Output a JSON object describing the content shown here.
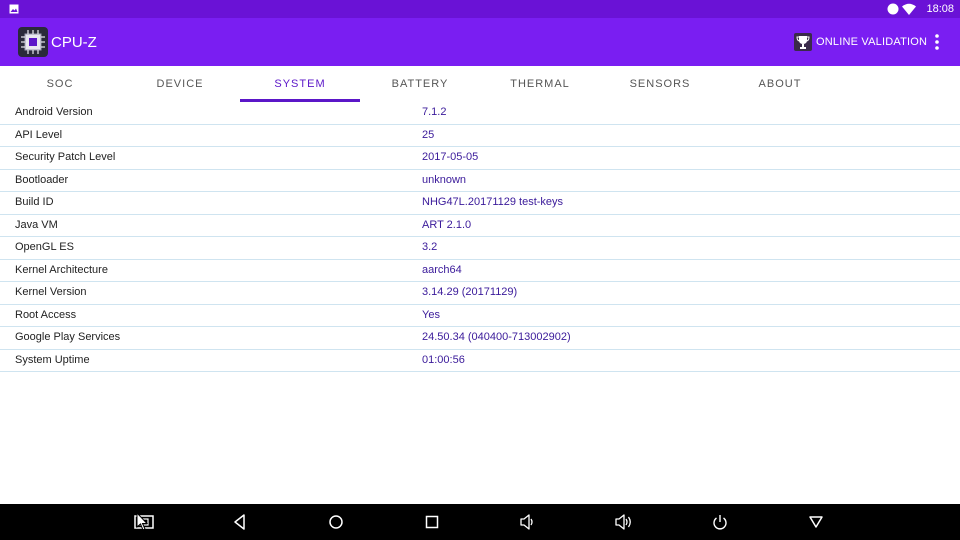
{
  "status_bar": {
    "time": "18:08"
  },
  "app_bar": {
    "title": "CPU-Z",
    "validation_label": "ONLINE VALIDATION",
    "accent_color": "#7a1ef2"
  },
  "tabs": [
    {
      "label": "SOC",
      "active": false
    },
    {
      "label": "DEVICE",
      "active": false
    },
    {
      "label": "SYSTEM",
      "active": true
    },
    {
      "label": "BATTERY",
      "active": false
    },
    {
      "label": "THERMAL",
      "active": false
    },
    {
      "label": "SENSORS",
      "active": false
    },
    {
      "label": "ABOUT",
      "active": false
    }
  ],
  "system_rows": [
    {
      "key": "Android Version",
      "value": "7.1.2"
    },
    {
      "key": "API Level",
      "value": "25"
    },
    {
      "key": "Security Patch Level",
      "value": "2017-05-05"
    },
    {
      "key": "Bootloader",
      "value": "unknown"
    },
    {
      "key": "Build ID",
      "value": "NHG47L.20171129 test-keys"
    },
    {
      "key": "Java VM",
      "value": "ART 2.1.0"
    },
    {
      "key": "OpenGL ES",
      "value": "3.2"
    },
    {
      "key": "Kernel Architecture",
      "value": "aarch64"
    },
    {
      "key": "Kernel Version",
      "value": "3.14.29 (20171129)"
    },
    {
      "key": "Root Access",
      "value": "Yes"
    },
    {
      "key": "Google Play Services",
      "value": "24.50.34 (040400-713002902)"
    },
    {
      "key": "System Uptime",
      "value": "01:00:56"
    }
  ],
  "nav_bar": {
    "icons": [
      "screenshot-icon",
      "back-icon",
      "home-icon",
      "recents-icon",
      "volume-down-icon",
      "volume-up-icon",
      "power-icon",
      "dropdown-icon"
    ]
  }
}
